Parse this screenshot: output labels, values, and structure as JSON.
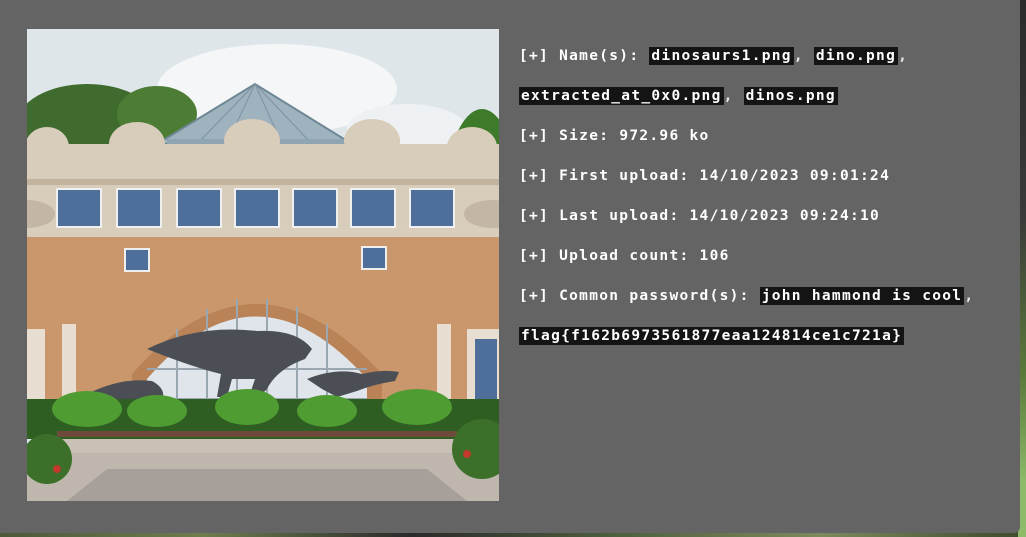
{
  "image": {
    "alt_icon": "museum-photo"
  },
  "info": {
    "names_label": "[+] Name(s): ",
    "names": [
      "dinosaurs1.png",
      "dino.png",
      "extracted_at_0x0.png",
      "dinos.png"
    ],
    "separator": ", ",
    "size_label": "[+] Size: ",
    "size_value": "972.96 ko",
    "first_upload_label": "[+] First upload: ",
    "first_upload_value": "14/10/2023 09:01:24",
    "last_upload_label": "[+] Last upload: ",
    "last_upload_value": "14/10/2023 09:24:10",
    "upload_count_label": "[+] Upload count: ",
    "upload_count_value": "106",
    "passwords_label": "[+] Common password(s): ",
    "passwords": [
      "john hammond is cool",
      "flag{f162b6973561877eaa124814ce1c721a}"
    ],
    "trailing_comma": ","
  }
}
